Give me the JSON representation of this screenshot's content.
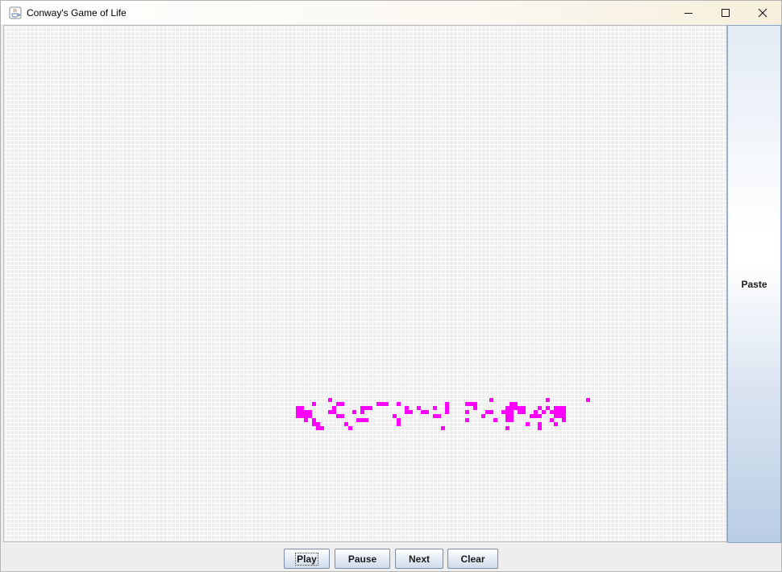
{
  "window": {
    "title": "Conway's Game of Life",
    "icon": "java-cup-icon",
    "controls": [
      "minimize-icon",
      "maximize-icon",
      "close-icon"
    ]
  },
  "grid": {
    "cell_color": "#ff00ff",
    "background_color": "#eeeeee",
    "gridline_color": "#ffffff",
    "live_cells": [
      [
        80,
        92
      ],
      [
        120,
        92
      ],
      [
        134,
        92
      ],
      [
        144,
        92
      ],
      [
        76,
        93
      ],
      [
        82,
        93
      ],
      [
        83,
        93
      ],
      [
        92,
        93
      ],
      [
        93,
        93
      ],
      [
        94,
        93
      ],
      [
        97,
        93
      ],
      [
        109,
        93
      ],
      [
        114,
        93
      ],
      [
        115,
        93
      ],
      [
        116,
        93
      ],
      [
        125,
        93
      ],
      [
        126,
        93
      ],
      [
        72,
        94
      ],
      [
        73,
        94
      ],
      [
        81,
        94
      ],
      [
        88,
        94
      ],
      [
        89,
        94
      ],
      [
        90,
        94
      ],
      [
        99,
        94
      ],
      [
        102,
        94
      ],
      [
        106,
        94
      ],
      [
        109,
        94
      ],
      [
        116,
        94
      ],
      [
        124,
        94
      ],
      [
        125,
        94
      ],
      [
        126,
        94
      ],
      [
        127,
        94
      ],
      [
        128,
        94
      ],
      [
        132,
        94
      ],
      [
        134,
        94
      ],
      [
        136,
        94
      ],
      [
        137,
        94
      ],
      [
        138,
        94
      ],
      [
        72,
        95
      ],
      [
        73,
        95
      ],
      [
        74,
        95
      ],
      [
        75,
        95
      ],
      [
        80,
        95
      ],
      [
        81,
        95
      ],
      [
        86,
        95
      ],
      [
        88,
        95
      ],
      [
        99,
        95
      ],
      [
        100,
        95
      ],
      [
        103,
        95
      ],
      [
        104,
        95
      ],
      [
        109,
        95
      ],
      [
        114,
        95
      ],
      [
        119,
        95
      ],
      [
        120,
        95
      ],
      [
        123,
        95
      ],
      [
        124,
        95
      ],
      [
        125,
        95
      ],
      [
        127,
        95
      ],
      [
        128,
        95
      ],
      [
        131,
        95
      ],
      [
        133,
        95
      ],
      [
        135,
        95
      ],
      [
        136,
        95
      ],
      [
        137,
        95
      ],
      [
        138,
        95
      ],
      [
        72,
        96
      ],
      [
        73,
        96
      ],
      [
        74,
        96
      ],
      [
        75,
        96
      ],
      [
        82,
        96
      ],
      [
        83,
        96
      ],
      [
        96,
        96
      ],
      [
        106,
        96
      ],
      [
        107,
        96
      ],
      [
        118,
        96
      ],
      [
        124,
        96
      ],
      [
        125,
        96
      ],
      [
        130,
        96
      ],
      [
        131,
        96
      ],
      [
        132,
        96
      ],
      [
        136,
        96
      ],
      [
        137,
        96
      ],
      [
        138,
        96
      ],
      [
        74,
        97
      ],
      [
        76,
        97
      ],
      [
        87,
        97
      ],
      [
        88,
        97
      ],
      [
        89,
        97
      ],
      [
        97,
        97
      ],
      [
        114,
        97
      ],
      [
        121,
        97
      ],
      [
        124,
        97
      ],
      [
        125,
        97
      ],
      [
        135,
        97
      ],
      [
        138,
        97
      ],
      [
        76,
        98
      ],
      [
        77,
        98
      ],
      [
        84,
        98
      ],
      [
        97,
        98
      ],
      [
        129,
        98
      ],
      [
        132,
        98
      ],
      [
        136,
        98
      ],
      [
        77,
        99
      ],
      [
        78,
        99
      ],
      [
        85,
        99
      ],
      [
        108,
        99
      ],
      [
        124,
        99
      ],
      [
        132,
        99
      ]
    ]
  },
  "sidebar": {
    "paste_label": "Paste"
  },
  "controls": {
    "play_label": "Play",
    "pause_label": "Pause",
    "next_label": "Next",
    "clear_label": "Clear"
  }
}
